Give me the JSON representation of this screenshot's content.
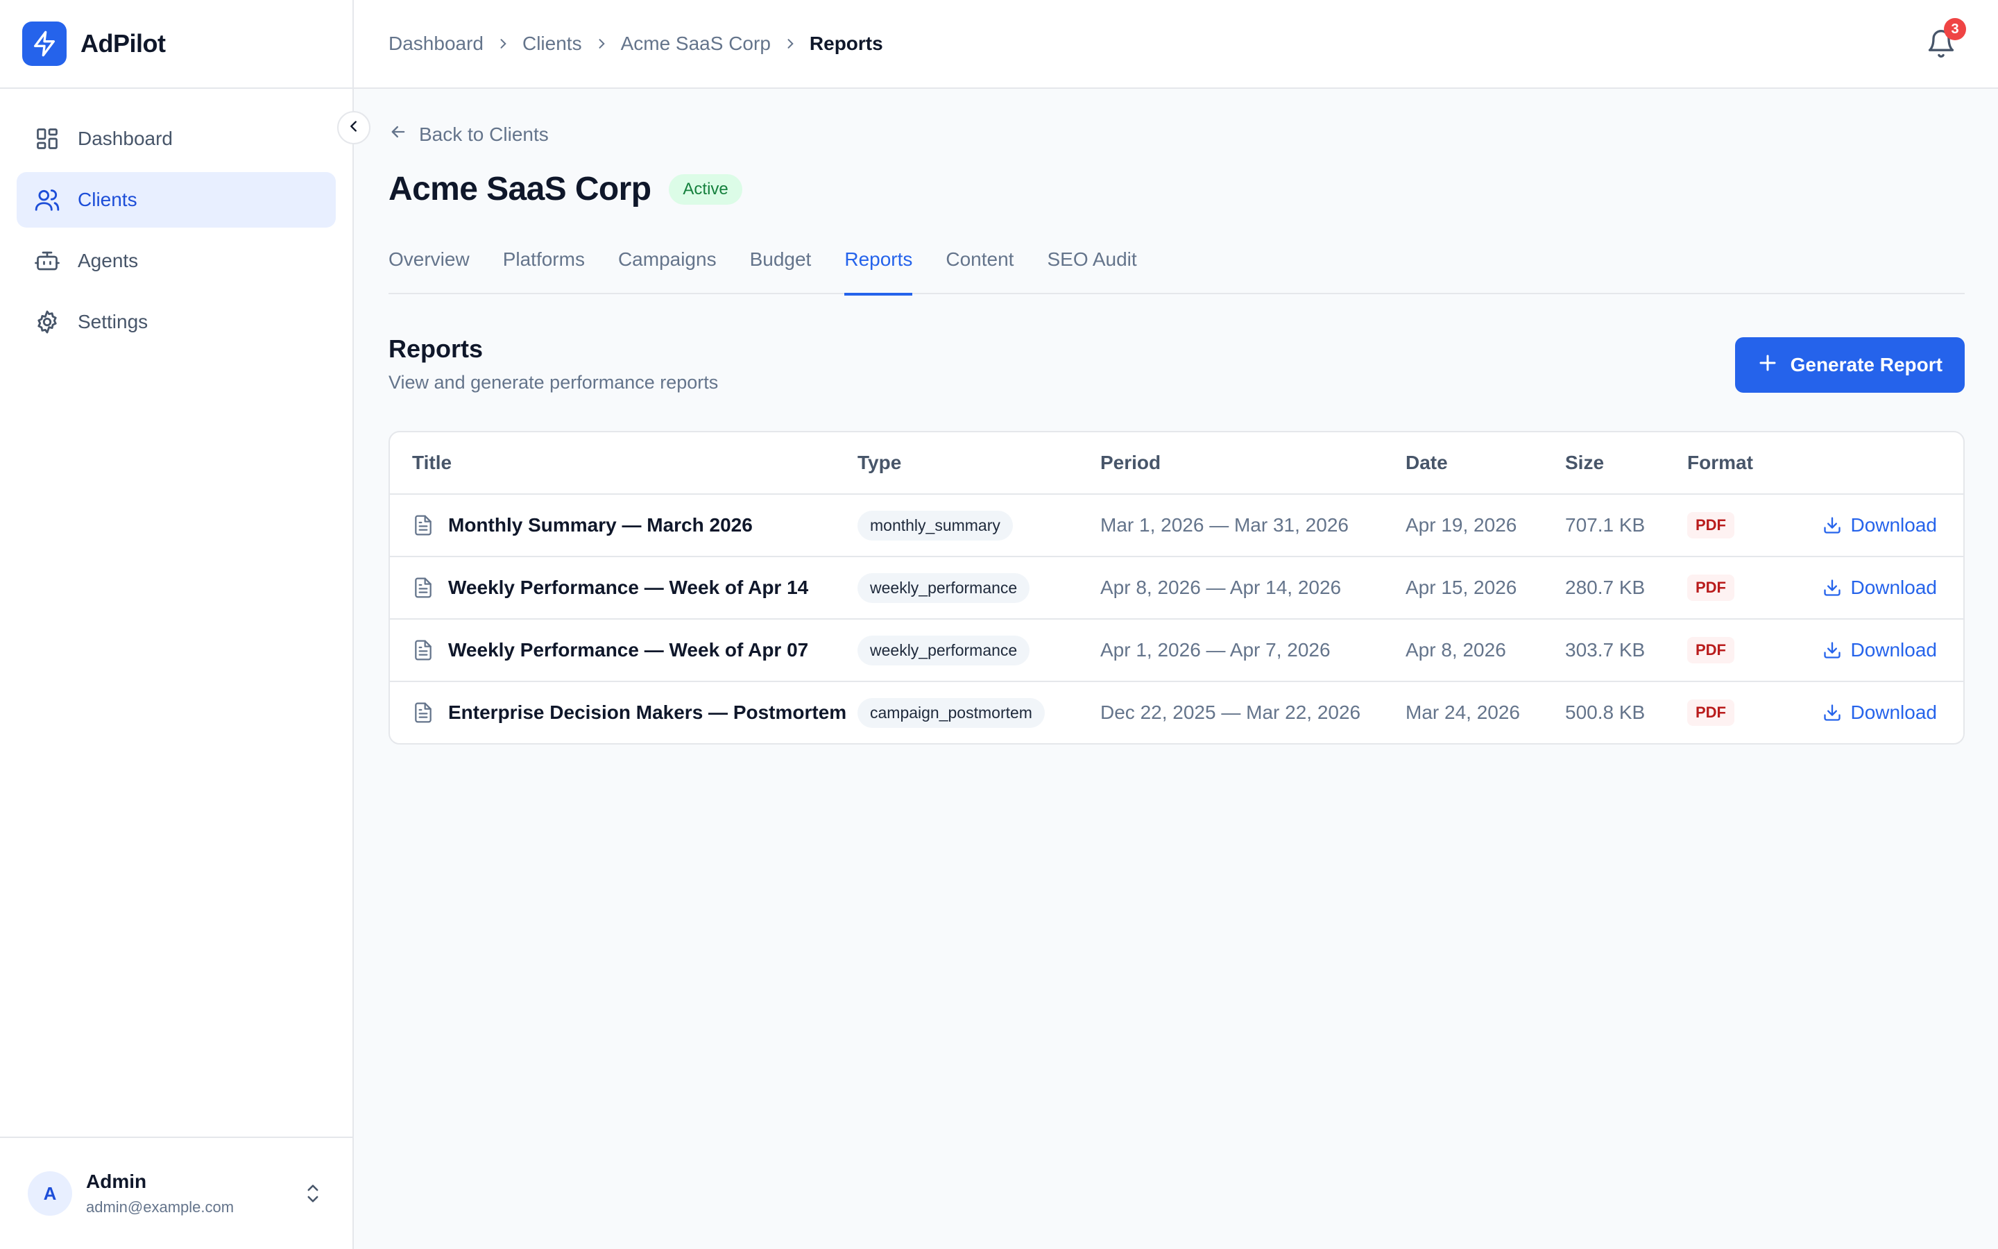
{
  "app": {
    "name": "AdPilot"
  },
  "sidebar": {
    "items": [
      {
        "label": "Dashboard",
        "icon": "dashboard-icon",
        "active": false
      },
      {
        "label": "Clients",
        "icon": "users-icon",
        "active": true
      },
      {
        "label": "Agents",
        "icon": "bot-icon",
        "active": false
      },
      {
        "label": "Settings",
        "icon": "gear-icon",
        "active": false
      }
    ],
    "user": {
      "initial": "A",
      "name": "Admin",
      "email": "admin@example.com"
    }
  },
  "breadcrumb": [
    "Dashboard",
    "Clients",
    "Acme SaaS Corp",
    "Reports"
  ],
  "notifications": {
    "count": "3"
  },
  "client": {
    "back_label": "Back to Clients",
    "name": "Acme SaaS Corp",
    "status": "Active"
  },
  "tabs": [
    {
      "label": "Overview",
      "active": false
    },
    {
      "label": "Platforms",
      "active": false
    },
    {
      "label": "Campaigns",
      "active": false
    },
    {
      "label": "Budget",
      "active": false
    },
    {
      "label": "Reports",
      "active": true
    },
    {
      "label": "Content",
      "active": false
    },
    {
      "label": "SEO Audit",
      "active": false
    }
  ],
  "reports": {
    "title": "Reports",
    "subtitle": "View and generate performance reports",
    "generate_label": "Generate Report",
    "columns": [
      "Title",
      "Type",
      "Period",
      "Date",
      "Size",
      "Format"
    ],
    "rows": [
      {
        "title": "Monthly Summary — March 2026",
        "type": "monthly_summary",
        "period": "Mar 1, 2026 — Mar 31, 2026",
        "date": "Apr 19, 2026",
        "size": "707.1 KB",
        "format": "PDF",
        "action": "Download"
      },
      {
        "title": "Weekly Performance — Week of Apr 14",
        "type": "weekly_performance",
        "period": "Apr 8, 2026 — Apr 14, 2026",
        "date": "Apr 15, 2026",
        "size": "280.7 KB",
        "format": "PDF",
        "action": "Download"
      },
      {
        "title": "Weekly Performance — Week of Apr 07",
        "type": "weekly_performance",
        "period": "Apr 1, 2026 — Apr 7, 2026",
        "date": "Apr 8, 2026",
        "size": "303.7 KB",
        "format": "PDF",
        "action": "Download"
      },
      {
        "title": "Enterprise Decision Makers — Postmortem",
        "type": "campaign_postmortem",
        "period": "Dec 22, 2025 — Mar 22, 2026",
        "date": "Mar 24, 2026",
        "size": "500.8 KB",
        "format": "PDF",
        "action": "Download"
      }
    ]
  },
  "colors": {
    "accent": "#2563eb",
    "active_bg": "#e8efff",
    "status_green": "#15803d",
    "pdf_red": "#b91c1c",
    "badge_red": "#ef4444"
  }
}
